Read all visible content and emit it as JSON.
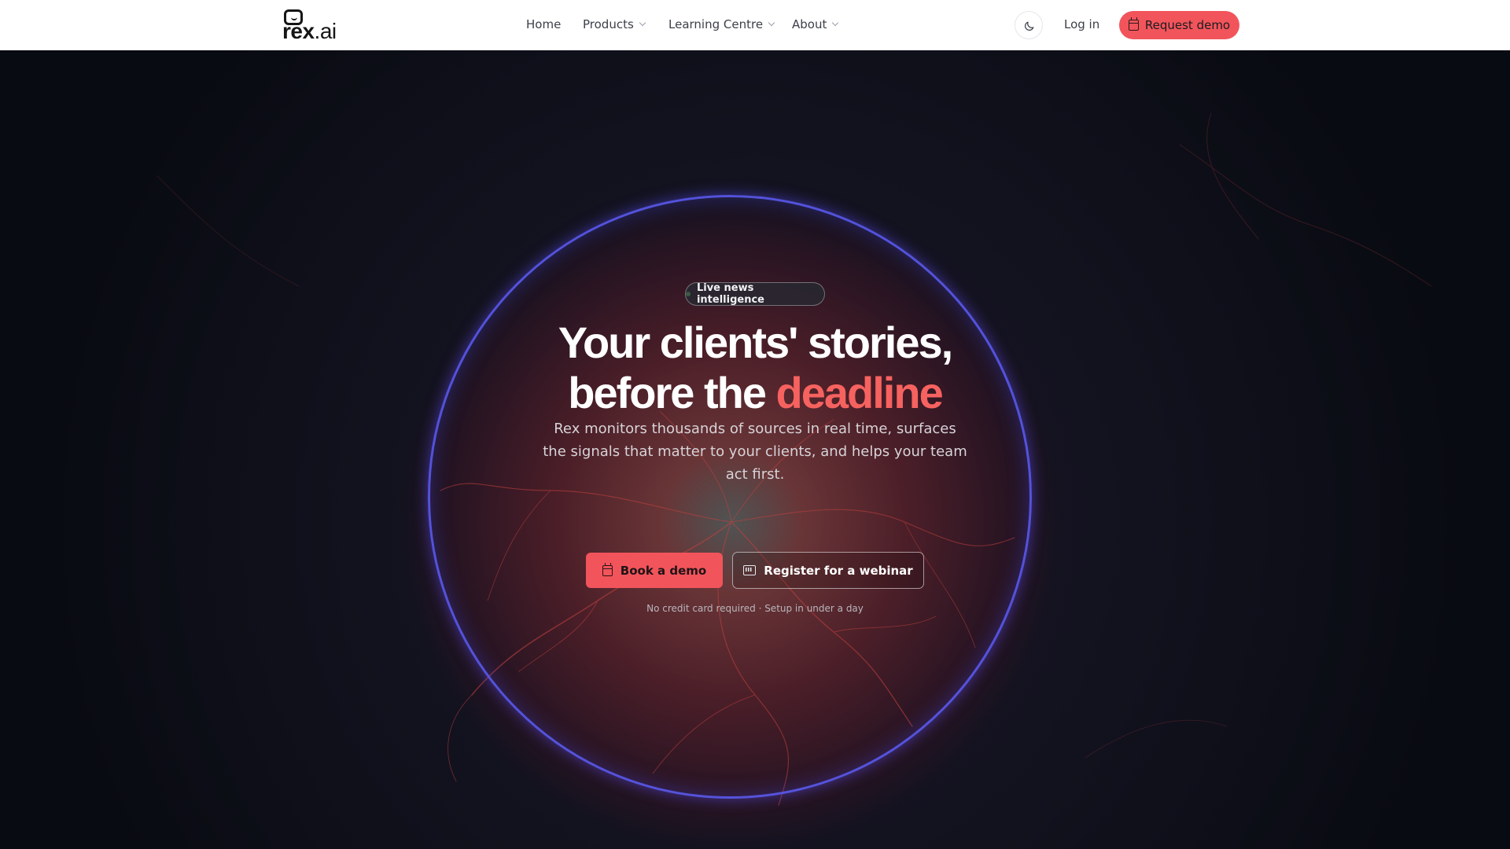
{
  "brand": {
    "name_bold": "rex",
    "name_light": ".ai"
  },
  "nav": {
    "home": "Home",
    "products": "Products",
    "learning_centre": "Learning Centre",
    "about": "About"
  },
  "header": {
    "theme_toggle_icon": "moon-icon",
    "login": "Log in",
    "request_demo": "Request demo",
    "request_demo_icon": "calendar-icon"
  },
  "hero": {
    "badge": "Live news intelligence",
    "headline_line1": "Your clients' stories,",
    "headline_line2_prefix": "before the ",
    "headline_line2_accent": "deadline",
    "subtitle": "Rex monitors thousands of sources in real time, surfaces the signals that matter to your clients, and helps your team act first.",
    "primary_cta": "Book a demo",
    "primary_cta_icon": "calendar-icon",
    "secondary_cta": "Register for a webinar",
    "secondary_cta_icon": "presentation-icon",
    "note": "No credit card required · Setup in under a day"
  },
  "colors": {
    "accent": "#f2545b",
    "headline_accent": "#f6625f",
    "ring": "#5a5af0",
    "header_bg": "#ffffff",
    "hero_bg": "#0a0c14"
  }
}
